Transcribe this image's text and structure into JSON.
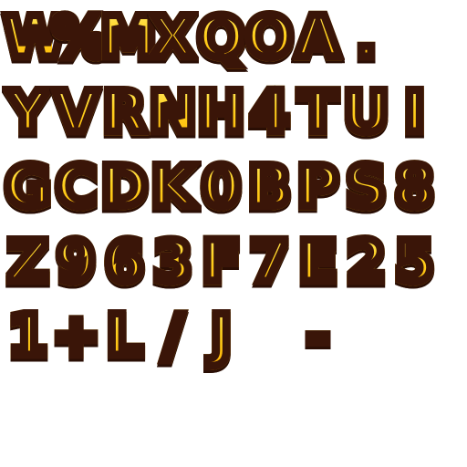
{
  "rows": [
    [
      "W",
      "%",
      "M",
      "X",
      "Q",
      "O",
      "A",
      "."
    ],
    [
      "Y",
      "V",
      "R",
      "N",
      "H",
      "4",
      "T",
      "U",
      "I"
    ],
    [
      "G",
      "C",
      "D",
      "K",
      "0",
      "B",
      "P",
      "S",
      "8"
    ],
    [
      "Z",
      "9",
      "6",
      "3",
      "F",
      "7",
      "E",
      "2",
      "5"
    ],
    [
      "1",
      "+",
      "L",
      "/",
      "J",
      " ",
      "-"
    ]
  ],
  "colors": {
    "fill_top": "#fff07a",
    "fill_mid": "#ffd21f",
    "fill_bottom": "#ffae00",
    "outline": "#3a1508"
  }
}
